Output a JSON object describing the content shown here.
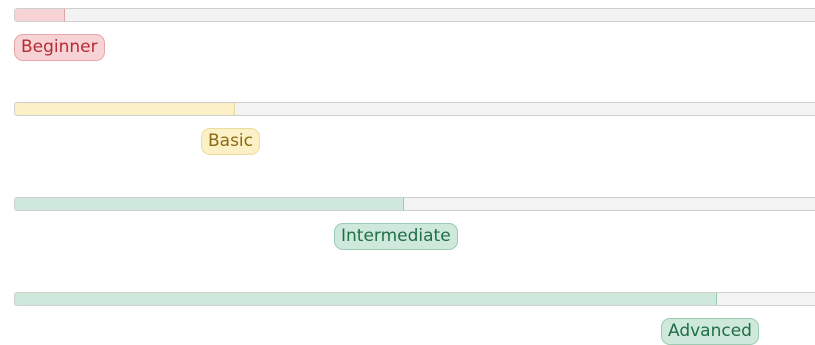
{
  "skills": [
    {
      "label": "Beginner",
      "level": 0.062,
      "color": "#f8d3d6"
    },
    {
      "label": "Basic",
      "level": 0.275,
      "color": "#fbf0c6"
    },
    {
      "label": "Intermediate",
      "level": 0.486,
      "color": "#cfe8dc"
    },
    {
      "label": "Advanced",
      "level": 0.878,
      "color": "#cfe8dc"
    }
  ]
}
